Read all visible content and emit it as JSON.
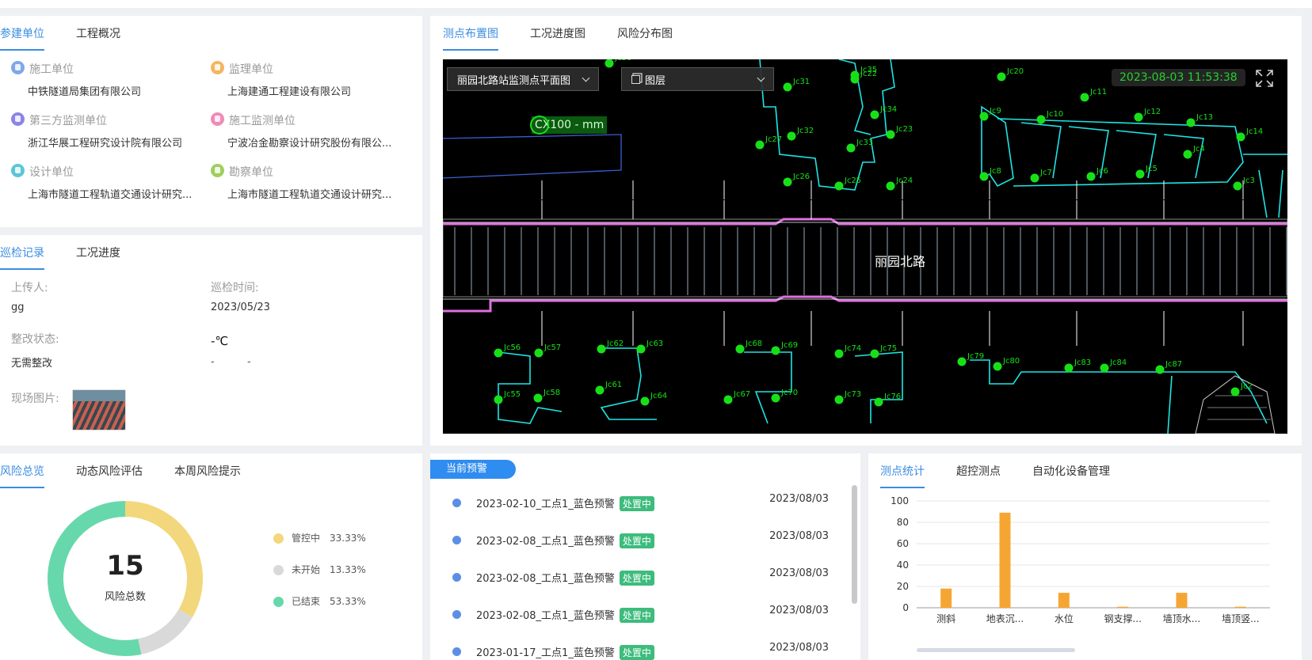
{
  "units": {
    "tabs": [
      "参建单位",
      "工程概况"
    ],
    "items": [
      {
        "icon": "construction-unit-icon",
        "label": "施工单位",
        "value": "中铁隧道局集团有限公司",
        "color": "#7fa8e8"
      },
      {
        "icon": "supervision-unit-icon",
        "label": "监理单位",
        "value": "上海建通工程建设有限公司",
        "color": "#f3b65f"
      },
      {
        "icon": "third-party-monitor-icon",
        "label": "第三方监测单位",
        "value": "浙江华展工程研究设计院有限公司",
        "color": "#8c85e6"
      },
      {
        "icon": "construction-monitor-icon",
        "label": "施工监测单位",
        "value": "宁波冶金勘察设计研究股份有限公...",
        "color": "#ef8bb8"
      },
      {
        "icon": "design-unit-icon",
        "label": "设计单位",
        "value": "上海市隧道工程轨道交通设计研究...",
        "color": "#5cc6d6"
      },
      {
        "icon": "survey-unit-icon",
        "label": "勘察单位",
        "value": "上海市隧道工程轨道交通设计研究...",
        "color": "#9ecf5e"
      }
    ]
  },
  "patrol": {
    "tabs": [
      "巡检记录",
      "工况进度"
    ],
    "uploader_label": "上传人:",
    "uploader": "gg",
    "time_label": "巡检时间:",
    "time": "2023/05/23",
    "status_label": "整改状态:",
    "status": "无需整改",
    "temp": "-℃",
    "dash": "-          -",
    "photo_label": "现场图片:"
  },
  "map": {
    "tabs": [
      "测点布置图",
      "工况进度图",
      "风险分布图"
    ],
    "plan_select": "丽园北路站监测点平面图",
    "layer_select": "图层",
    "datetime": "2023-08-03 11:53:38",
    "measure_label": "CX100 - mm",
    "road_label": "丽园北路"
  },
  "risk": {
    "tabs": [
      "风险总览",
      "动态风险评估",
      "本周风险提示"
    ],
    "total": "15",
    "total_label": "风险总数",
    "legend": [
      {
        "label": "管控中",
        "pct": "33.33%",
        "color": "#f3d77c",
        "value": 33.33
      },
      {
        "label": "未开始",
        "pct": "13.33%",
        "color": "#d9d9d9",
        "value": 13.33
      },
      {
        "label": "已结束",
        "pct": "53.33%",
        "color": "#67d8ac",
        "value": 53.33
      }
    ]
  },
  "warnings": {
    "title": "当前预警",
    "items": [
      {
        "text": "2023-02-10_工点1_蓝色预警",
        "badge": "处置中",
        "date": "2023/08/03"
      },
      {
        "text": "2023-02-08_工点1_蓝色预警",
        "badge": "处置中",
        "date": "2023/08/03"
      },
      {
        "text": "2023-02-08_工点1_蓝色预警",
        "badge": "处置中",
        "date": "2023/08/03"
      },
      {
        "text": "2023-02-08_工点1_蓝色预警",
        "badge": "处置中",
        "date": "2023/08/03"
      },
      {
        "text": "2023-01-17_工点1_蓝色预警",
        "badge": "处置中",
        "date": "2023/08/03"
      }
    ]
  },
  "stats": {
    "tabs": [
      "测点统计",
      "超控测点",
      "自动化设备管理"
    ]
  },
  "chart_data": {
    "type": "bar",
    "categories": [
      "测斜",
      "地表沉...",
      "水位",
      "钢支撑...",
      "墙顶水...",
      "墙顶竖..."
    ],
    "values": [
      18,
      89,
      14,
      1,
      14,
      1
    ],
    "ylim": [
      0,
      100
    ],
    "yticks": [
      0,
      20,
      40,
      60,
      80,
      100
    ],
    "bar_color": "#f5a632",
    "grid": true
  }
}
